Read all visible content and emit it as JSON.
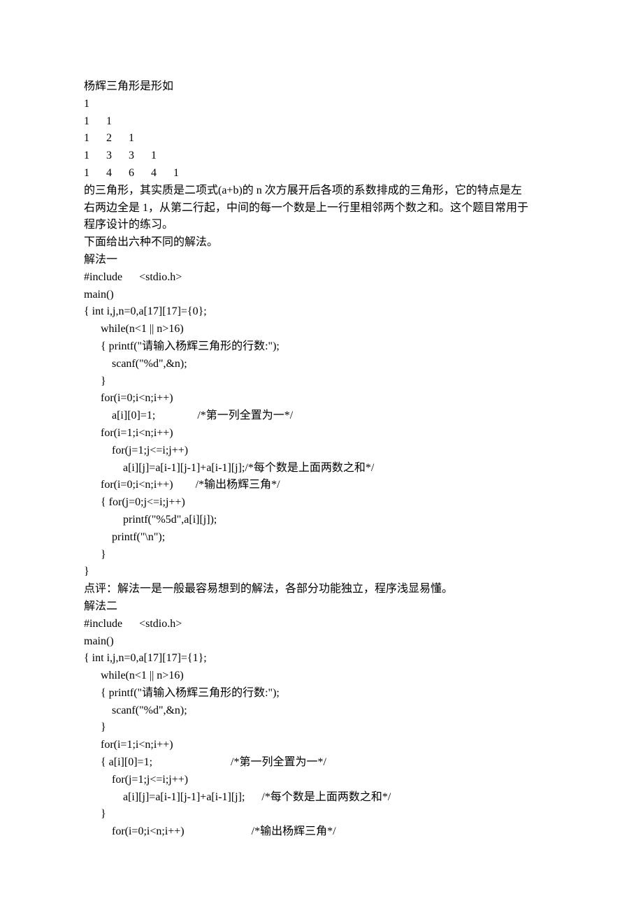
{
  "lines": [
    "杨辉三角形是形如",
    "1",
    "1      1",
    "1      2      1",
    "1      3      3      1",
    "1      4      6      4      1",
    "的三角形，其实质是二项式(a+b)的 n 次方展开后各项的系数排成的三角形，它的特点是左",
    "右两边全是 1，从第二行起，中间的每一个数是上一行里相邻两个数之和。这个题目常用于",
    "程序设计的练习。",
    "下面给出六种不同的解法。",
    "解法一",
    "#include      <stdio.h>",
    "main()",
    "{ int i,j,n=0,a[17][17]={0};",
    "      while(n<1 || n>16)",
    "      { printf(\"请输入杨辉三角形的行数:\");",
    "          scanf(\"%d\",&n);",
    "      }",
    "      for(i=0;i<n;i++)",
    "          a[i][0]=1;               /*第一列全置为一*/",
    "      for(i=1;i<n;i++)",
    "          for(j=1;j<=i;j++)",
    "              a[i][j]=a[i-1][j-1]+a[i-1][j];/*每个数是上面两数之和*/",
    "      for(i=0;i<n;i++)        /*输出杨辉三角*/",
    "      { for(j=0;j<=i;j++)",
    "              printf(\"%5d\",a[i][j]);",
    "          printf(\"\\n\");",
    "      }",
    "}",
    "点评：解法一是一般最容易想到的解法，各部分功能独立，程序浅显易懂。",
    "解法二",
    "#include      <stdio.h>",
    "main()",
    "{ int i,j,n=0,a[17][17]={1};",
    "      while(n<1 || n>16)",
    "      { printf(\"请输入杨辉三角形的行数:\");",
    "          scanf(\"%d\",&n);",
    "      }",
    "      for(i=1;i<n;i++)",
    "      { a[i][0]=1;                            /*第一列全置为一*/",
    "          for(j=1;j<=i;j++)",
    "              a[i][j]=a[i-1][j-1]+a[i-1][j];      /*每个数是上面两数之和*/",
    "      }",
    "          for(i=0;i<n;i++)                        /*输出杨辉三角*/"
  ]
}
